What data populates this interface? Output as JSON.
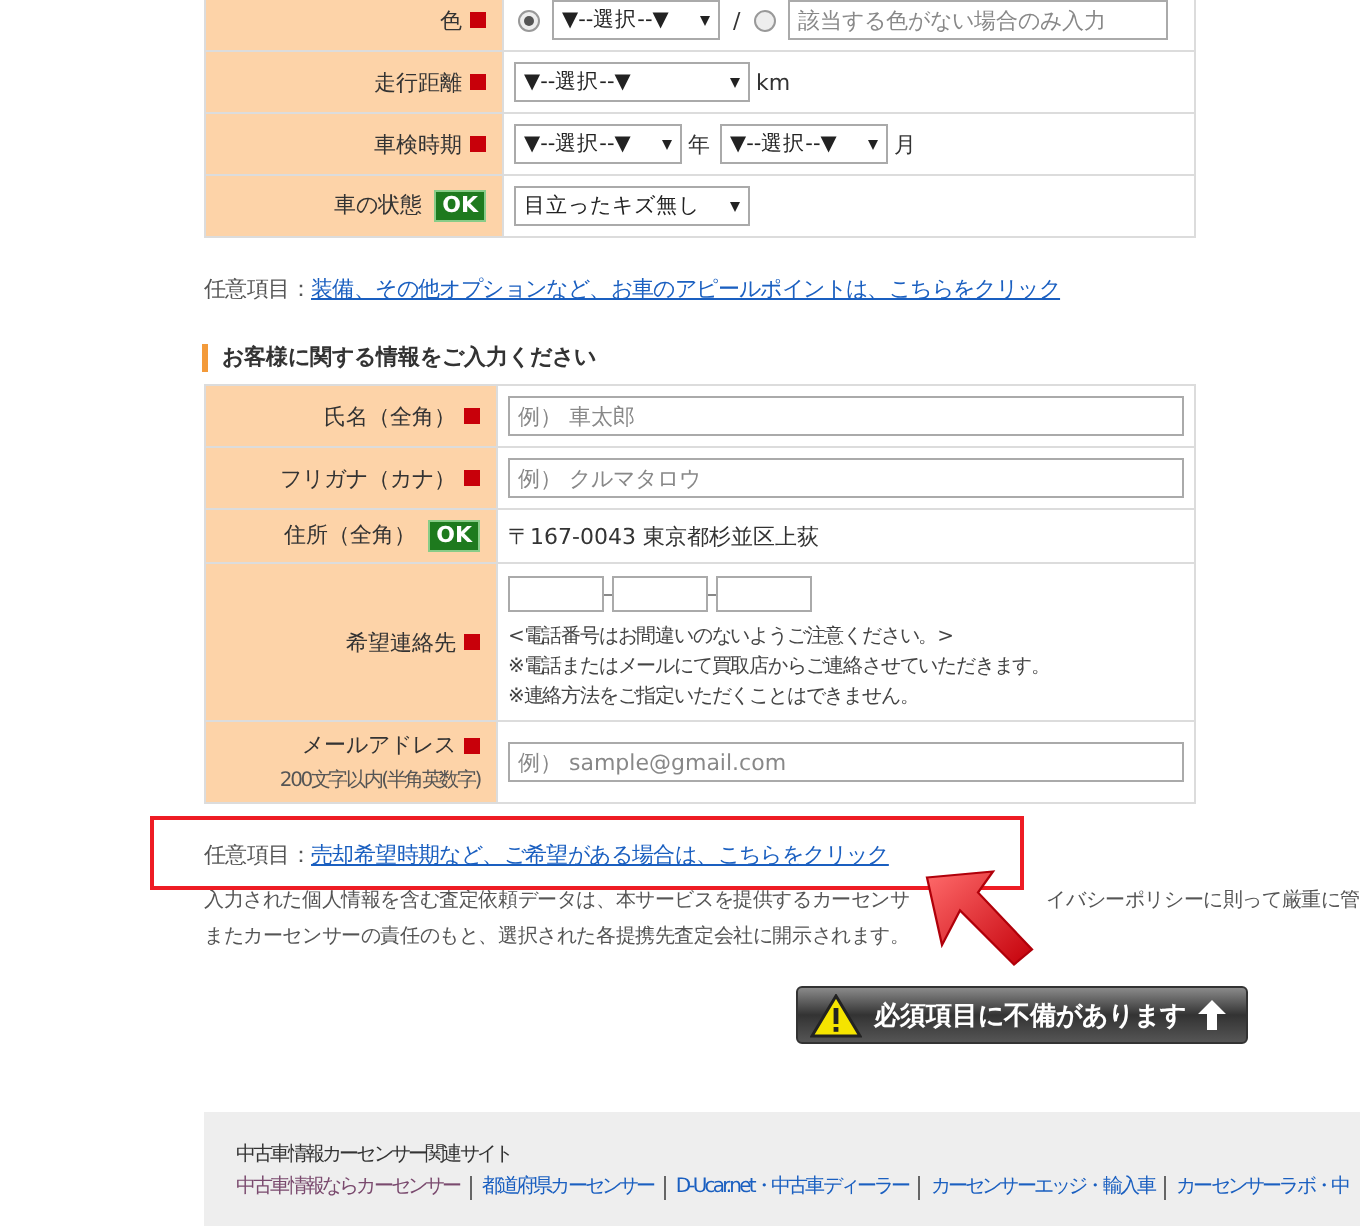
{
  "vehicle_form": {
    "rows": [
      {
        "kind": "color",
        "label": "色",
        "required": true,
        "radios": [
          {
            "selected": true
          },
          {
            "selected": false
          }
        ],
        "select": "▼--選択--▼",
        "separator": "/",
        "placeholder": "該当する色がない場合のみ入力"
      },
      {
        "kind": "select",
        "label": "走行距離",
        "required": true,
        "selects": [
          {
            "value": "▼--選択--▼",
            "unit": "km"
          }
        ]
      },
      {
        "kind": "select",
        "label": "車検時期",
        "required": true,
        "selects": [
          {
            "value": "▼--選択--▼",
            "unit": "年"
          },
          {
            "value": "▼--選択--▼",
            "unit": "月"
          }
        ]
      },
      {
        "kind": "select",
        "label": "車の状態",
        "required": false,
        "badge": "OK",
        "selects": [
          {
            "value": "目立ったキズ無し"
          }
        ]
      }
    ]
  },
  "vehicle_optional": {
    "prefix": "任意項目：",
    "link": "装備、その他オプションなど、お車のアピールポイントは、こちらをクリック"
  },
  "customer_form": {
    "heading": "お客様に関する情報をご入力ください",
    "rows": [
      {
        "kind": "input",
        "label": "氏名（全角）",
        "required": true,
        "placeholder": "例） 車太郎"
      },
      {
        "kind": "input",
        "label": "フリガナ（カナ）",
        "required": true,
        "placeholder": "例） クルマタロウ"
      },
      {
        "kind": "text",
        "label": "住所（全角）",
        "required": false,
        "badge": "OK",
        "value": "〒167-0043  東京都杉並区上荻"
      },
      {
        "kind": "phone",
        "label": "希望連絡先",
        "required": true,
        "notes": [
          "<電話番号はお間違いのないようご注意ください。>",
          "※電話またはメールにて買取店からご連絡させていただきます。",
          "※連絡方法をご指定いただくことはできません。"
        ]
      },
      {
        "kind": "input",
        "label": "メールアドレス",
        "sublabel": "200文字以内(半角英数字)",
        "required": true,
        "placeholder": "例） sample@gmail.com"
      }
    ]
  },
  "customer_optional": {
    "prefix": "任意項目：",
    "link": "売却希望時期など、ご希望がある場合は、こちらをクリック"
  },
  "privacy": {
    "line1_parts": [
      "入力された個人情報を含む査定依頼データは、本サービスを提供するカーセンサ",
      "イバシーポリシーに則って厳重に管"
    ],
    "line2": "またカーセンサーの責任のもと、選択された各提携先査定会社に開示されます。"
  },
  "submit_button": {
    "label": "必須項目に不備があります",
    "disabled": true
  },
  "footer": {
    "title": "中古車情報カーセンサー関連サイト",
    "links": [
      {
        "label": "中古車情報ならカーセンサー",
        "visited": true
      },
      {
        "label": "都道府県カーセンサー",
        "visited": false
      },
      {
        "label": "D-Ucar.net・中古車ディーラー",
        "visited": false
      },
      {
        "label": "カーセンサーエッジ・輸入車",
        "visited": false
      },
      {
        "label": "カーセンサーラボ・中",
        "visited": false
      }
    ]
  }
}
